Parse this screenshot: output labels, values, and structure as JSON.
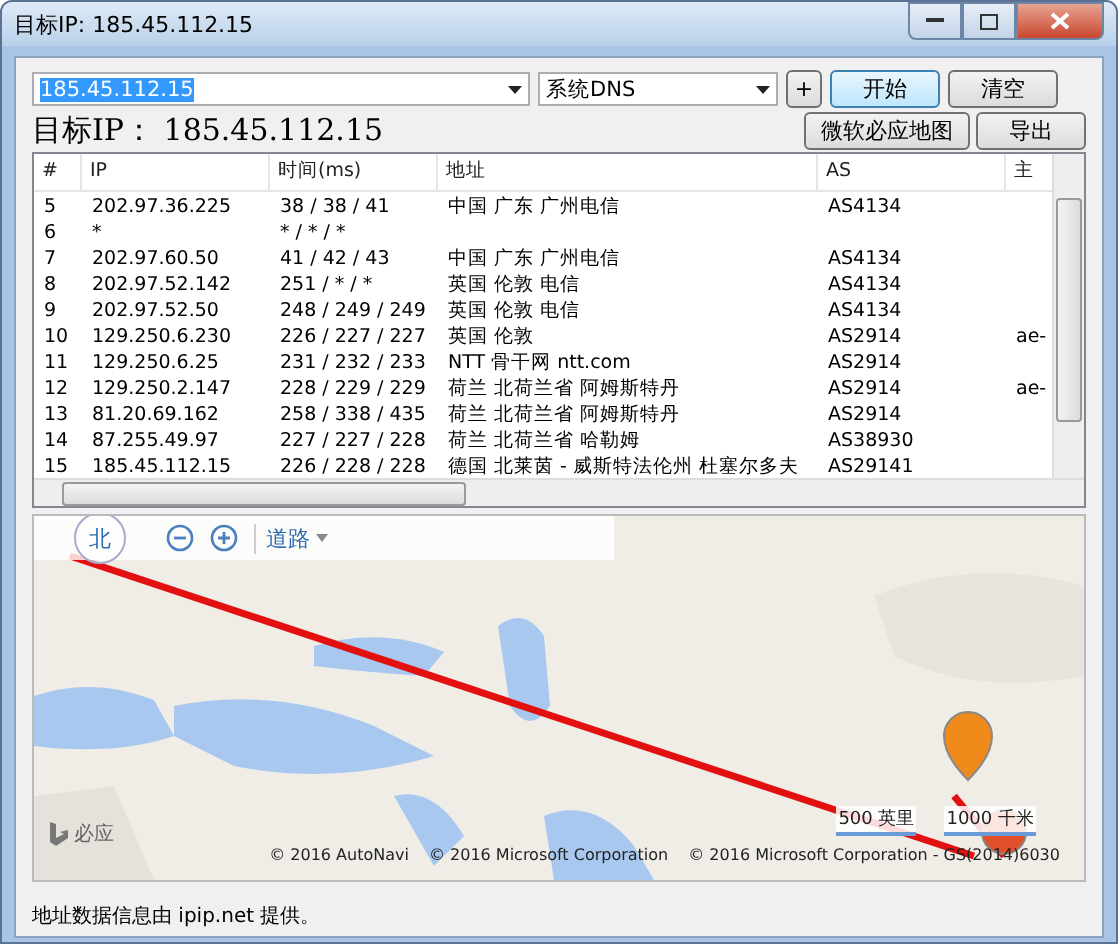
{
  "window": {
    "title": "目标IP: 185.45.112.15"
  },
  "target_field": {
    "value": "185.45.112.15"
  },
  "dns_select": {
    "value": "系统DNS"
  },
  "buttons_row1": [
    {
      "label": "+",
      "focused": false
    },
    {
      "label": "开始",
      "focused": true
    },
    {
      "label": "清空",
      "focused": false
    }
  ],
  "target_heading": "目标IP： 185.45.112.15",
  "buttons_row2": [
    {
      "label": "微软必应地图"
    },
    {
      "label": "导出"
    }
  ],
  "table": {
    "columns": [
      "#",
      "IP",
      "时间(ms)",
      "地址",
      "AS",
      "主"
    ],
    "rows": [
      [
        "5",
        "202.97.36.225",
        "38 / 38 / 41",
        "中国 广东 广州电信",
        "AS4134",
        ""
      ],
      [
        "6",
        "*",
        "* / * / *",
        "",
        "",
        ""
      ],
      [
        "7",
        "202.97.60.50",
        "41 / 42 / 43",
        "中国 广东 广州电信",
        "AS4134",
        ""
      ],
      [
        "8",
        "202.97.52.142",
        "251 / * / *",
        "英国 伦敦 电信",
        "AS4134",
        ""
      ],
      [
        "9",
        "202.97.52.50",
        "248 / 249 / 249",
        "英国 伦敦 电信",
        "AS4134",
        ""
      ],
      [
        "10",
        "129.250.6.230",
        "226 / 227 / 227",
        "英国 伦敦",
        "AS2914",
        "ae-"
      ],
      [
        "11",
        "129.250.6.25",
        "231 / 232 / 233",
        "NTT 骨干网 ntt.com",
        "AS2914",
        ""
      ],
      [
        "12",
        "129.250.2.147",
        "228 / 229 / 229",
        "荷兰 北荷兰省 阿姆斯特丹",
        "AS2914",
        "ae-"
      ],
      [
        "13",
        "81.20.69.162",
        "258 / 338 / 435",
        "荷兰 北荷兰省 阿姆斯特丹",
        "AS2914",
        ""
      ],
      [
        "14",
        "87.255.49.97",
        "227 / 227 / 228",
        "荷兰 北荷兰省 哈勒姆",
        "AS38930",
        ""
      ],
      [
        "15",
        "185.45.112.15",
        "226 / 228 / 228",
        "德国 北莱茵 - 威斯特法伦州 杜塞尔多夫",
        "AS29141",
        ""
      ]
    ]
  },
  "map": {
    "kind": "picture",
    "compass": "北",
    "layer": "道路",
    "logo": "必应",
    "scales": [
      "500 英里",
      "1000 千米"
    ],
    "copyrights": [
      "© 2016 AutoNavi",
      "© 2016 Microsoft Corporation",
      "© 2016 Microsoft Corporation - GS(2014)6030"
    ]
  },
  "footer": "地址数据信息由 ipip.net 提供。"
}
